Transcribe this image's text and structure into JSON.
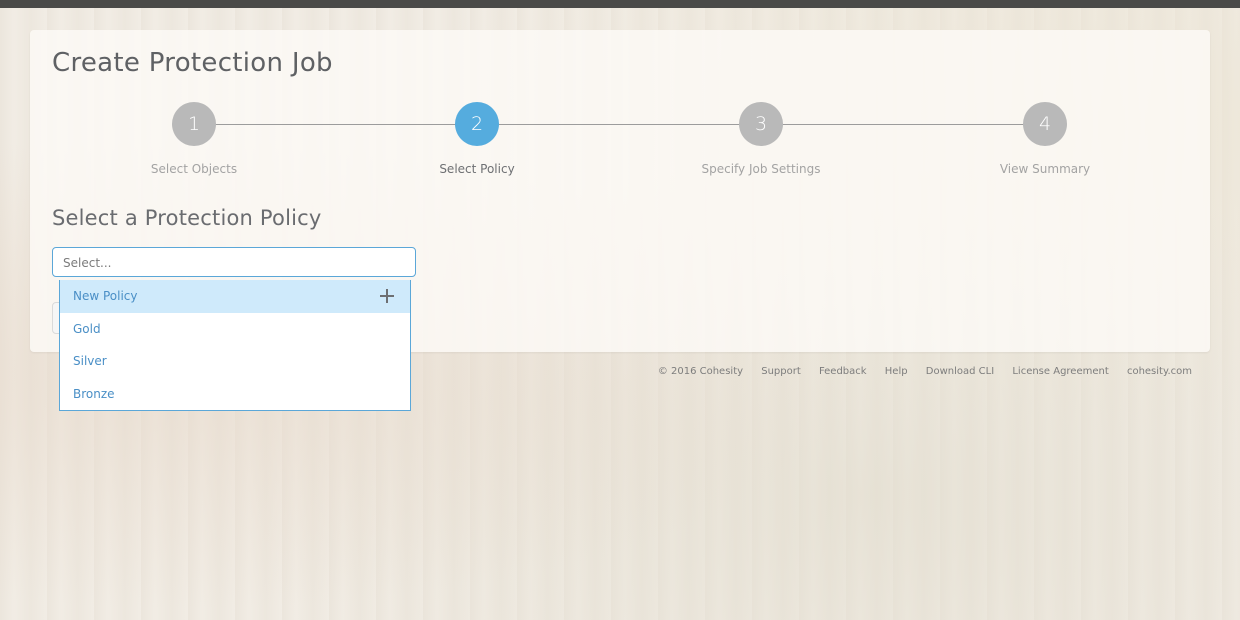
{
  "page": {
    "title": "Create Protection Job"
  },
  "stepper": {
    "steps": [
      {
        "number": "1",
        "label": "Select Objects",
        "state": "inactive"
      },
      {
        "number": "2",
        "label": "Select Policy",
        "state": "active"
      },
      {
        "number": "3",
        "label": "Specify Job Settings",
        "state": "inactive"
      },
      {
        "number": "4",
        "label": "View Summary",
        "state": "inactive"
      }
    ]
  },
  "policy_section": {
    "title": "Select a Protection Policy",
    "select": {
      "placeholder": "Select..."
    },
    "dropdown": {
      "items": [
        {
          "label": "New Policy",
          "icon": "plus-icon"
        },
        {
          "label": "Gold"
        },
        {
          "label": "Silver"
        },
        {
          "label": "Bronze"
        }
      ]
    }
  },
  "footer": {
    "copyright": "© 2016 Cohesity",
    "links": [
      "Support",
      "Feedback",
      "Help",
      "Download CLI",
      "License Agreement",
      "cohesity.com"
    ]
  },
  "colors": {
    "accent": "#55acde",
    "step_inactive": "#b9b9b9",
    "dropdown_highlight": "#cfeafb",
    "link_blue": "#4a8fc6"
  }
}
